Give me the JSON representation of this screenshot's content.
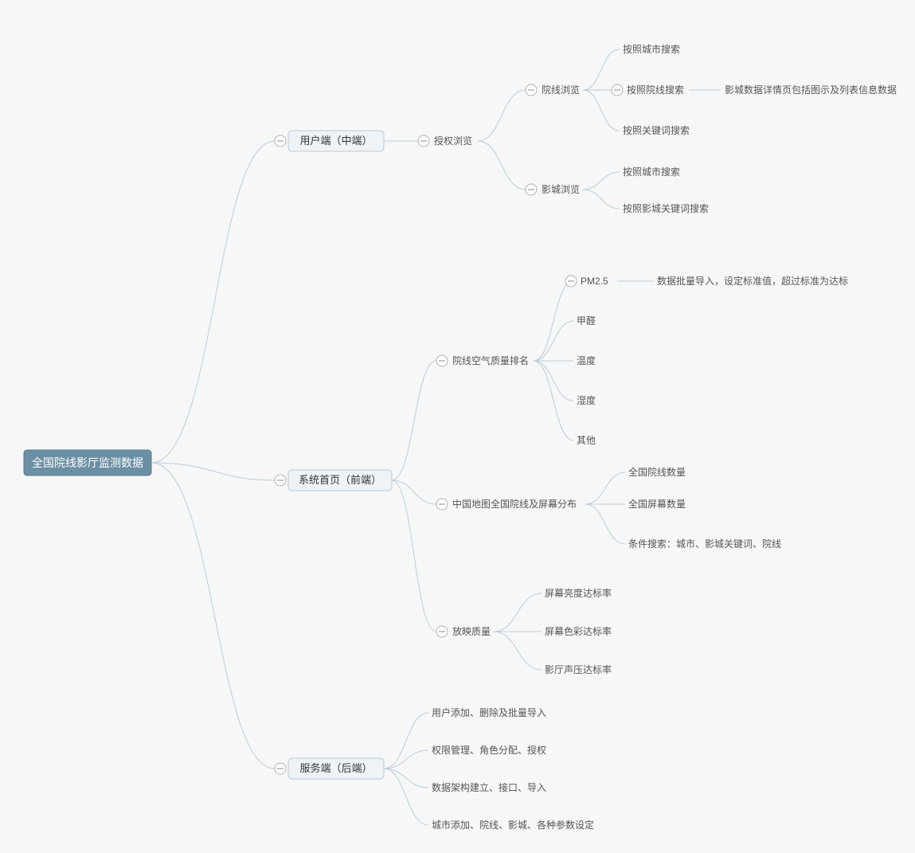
{
  "root": "全国院线影厅监测数据",
  "branches": [
    {
      "label": "用户端（中端）",
      "children": [
        {
          "label": "授权浏览",
          "children": [
            {
              "label": "院线浏览",
              "children": [
                {
                  "label": "按照城市搜索"
                },
                {
                  "label": "按照院线搜索",
                  "children": [
                    {
                      "label": "影城数据详情页包括图示及列表信息数据"
                    }
                  ]
                },
                {
                  "label": "按照关键词搜索"
                }
              ]
            },
            {
              "label": "影城浏览",
              "children": [
                {
                  "label": "按照城市搜索"
                },
                {
                  "label": "按照影城关键词搜索"
                }
              ]
            }
          ]
        }
      ]
    },
    {
      "label": "系统首页（前端）",
      "children": [
        {
          "label": "院线空气质量排名",
          "children": [
            {
              "label": "PM2.5",
              "children": [
                {
                  "label": "数据批量导入，设定标准值，超过标准为达标"
                }
              ]
            },
            {
              "label": "甲醛"
            },
            {
              "label": "温度"
            },
            {
              "label": "湿度"
            },
            {
              "label": "其他"
            }
          ]
        },
        {
          "label": "中国地图全国院线及屏幕分布",
          "children": [
            {
              "label": "全国院线数量"
            },
            {
              "label": "全国屏幕数量"
            },
            {
              "label": "条件搜索：城市、影城关键词、院线"
            }
          ]
        },
        {
          "label": "放映质量",
          "children": [
            {
              "label": "屏幕亮度达标率"
            },
            {
              "label": "屏幕色彩达标率"
            },
            {
              "label": "影厅声压达标率"
            }
          ]
        }
      ]
    },
    {
      "label": "服务端（后端）",
      "children": [
        {
          "label": "用户添加、删除及批量导入"
        },
        {
          "label": "权限管理、角色分配、授权"
        },
        {
          "label": "数据架构建立、接口、导入"
        },
        {
          "label": "城市添加、院线、影城、各种参数设定"
        }
      ]
    }
  ]
}
